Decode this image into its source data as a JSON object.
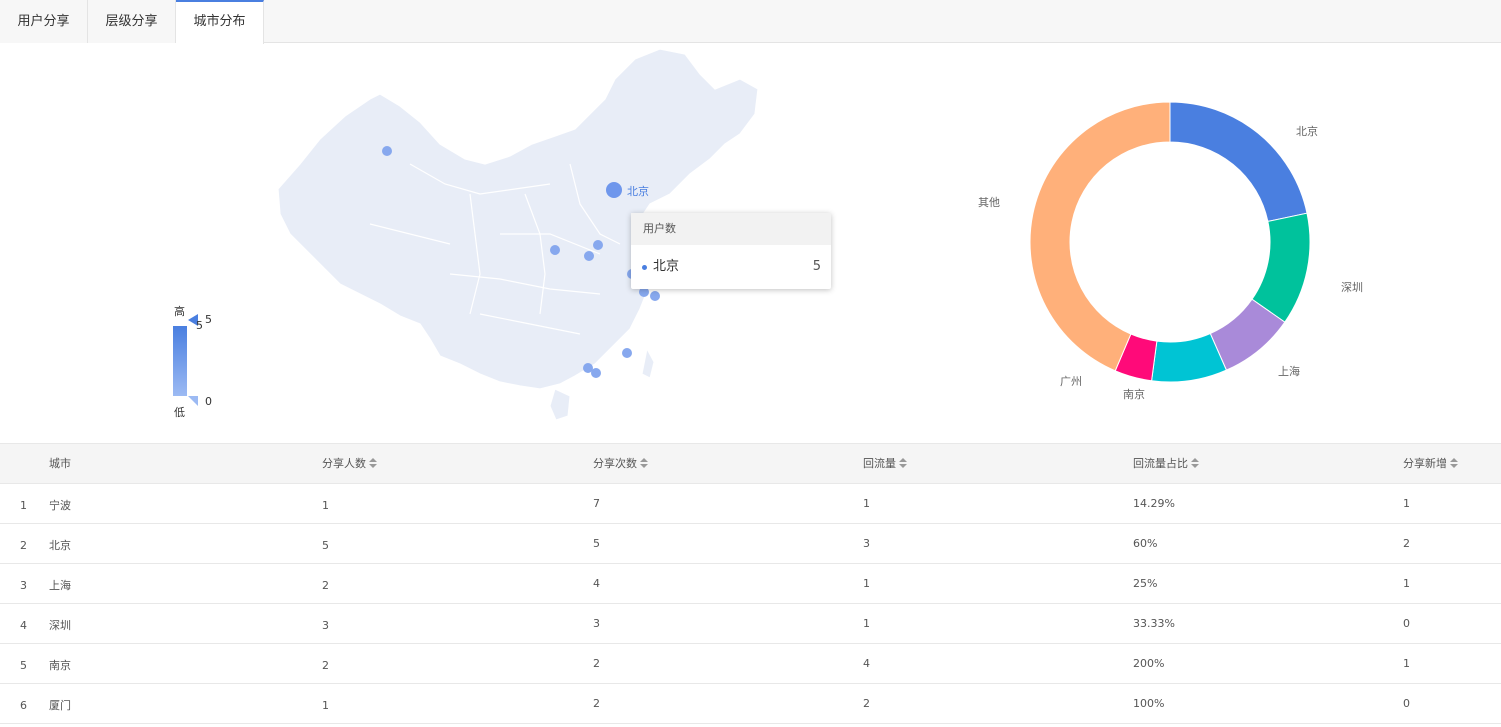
{
  "tabs": [
    {
      "label": "用户分享",
      "active": false
    },
    {
      "label": "层级分享",
      "active": false
    },
    {
      "label": "城市分布",
      "active": true
    }
  ],
  "map": {
    "highlight_city": "北京",
    "legend": {
      "high_label": "高",
      "low_label": "低",
      "max": "5",
      "min": "0",
      "current": "5"
    },
    "tooltip": {
      "title": "用户数",
      "name": "北京",
      "value": "5"
    }
  },
  "donut": {
    "slices": [
      {
        "name": "北京",
        "color": "#4a7fe0",
        "pct": 21.7
      },
      {
        "name": "深圳",
        "color": "#00c29c",
        "pct": 13.0
      },
      {
        "name": "上海",
        "color": "#a98ad9",
        "pct": 8.7
      },
      {
        "name": "南京",
        "color": "#00c4d4",
        "pct": 8.7
      },
      {
        "name": "广州",
        "color": "#ff0a79",
        "pct": 4.3
      },
      {
        "name": "其他",
        "color": "#ffb07a",
        "pct": 43.6
      }
    ]
  },
  "table": {
    "columns": [
      "城市",
      "分享人数",
      "分享次数",
      "回流量",
      "回流量占比",
      "分享新增"
    ],
    "rows": [
      [
        "1",
        "宁波",
        "1",
        "7",
        "1",
        "14.29%",
        "1"
      ],
      [
        "2",
        "北京",
        "5",
        "5",
        "3",
        "60%",
        "2"
      ],
      [
        "3",
        "上海",
        "2",
        "4",
        "1",
        "25%",
        "1"
      ],
      [
        "4",
        "深圳",
        "3",
        "3",
        "1",
        "33.33%",
        "0"
      ],
      [
        "5",
        "南京",
        "2",
        "2",
        "4",
        "200%",
        "1"
      ],
      [
        "6",
        "厦门",
        "1",
        "2",
        "2",
        "100%",
        "0"
      ]
    ]
  }
}
